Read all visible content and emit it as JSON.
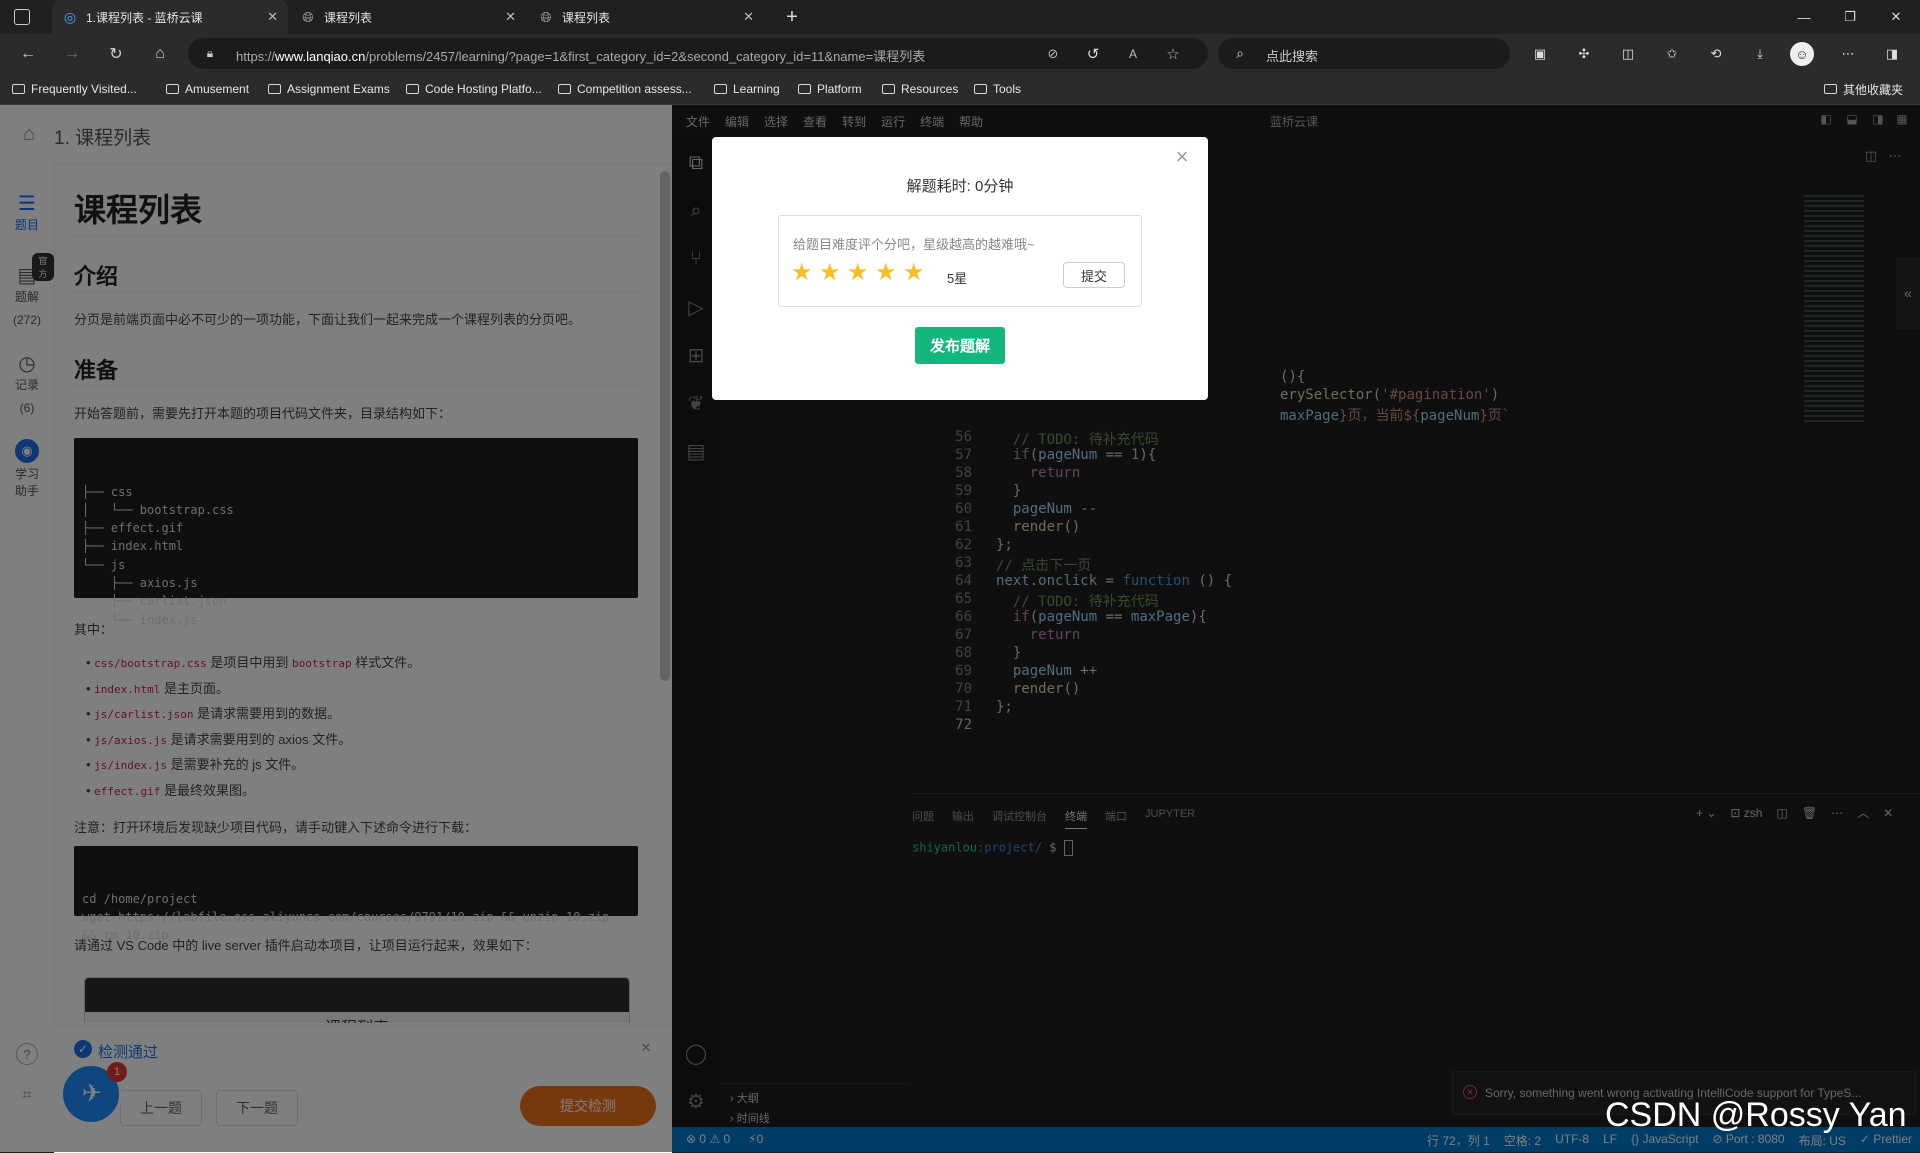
{
  "browser": {
    "tabs": [
      {
        "label": "1.课程列表 - 蓝桥云课",
        "active": true
      },
      {
        "label": "课程列表",
        "active": false
      },
      {
        "label": "课程列表",
        "active": false
      }
    ],
    "url_prefix": "https://",
    "url_host": "www.lanqiao.cn",
    "url_path": "/problems/2457/learning/?page=1&first_category_id=2&second_category_id=11&name=课程列表",
    "search_placeholder": "点此搜索",
    "bookmarks": [
      "Frequently Visited...",
      "Amusement",
      "Assignment Exams",
      "Code Hosting Platfo...",
      "Competition assess...",
      "Learning",
      "Platform",
      "Resources",
      "Tools"
    ],
    "other_bookmarks": "其他收藏夹"
  },
  "left": {
    "breadcrumb": "1. 课程列表",
    "rail": [
      {
        "label": "题目"
      },
      {
        "label": "题解",
        "count": "(272)",
        "badge": "官方"
      },
      {
        "label": "记录",
        "count": "(6)"
      },
      {
        "label": "学习\n助手"
      }
    ],
    "title": "课程列表",
    "intro_heading": "介绍",
    "intro_text": "分页是前端页面中必不可少的一项功能，下面让我们一起来完成一个课程列表的分页吧。",
    "prep_heading": "准备",
    "prep_text": "开始答题前，需要先打开本题的项目代码文件夹，目录结构如下：",
    "tree": [
      "├── css",
      "│   └── bootstrap.css",
      "├── effect.gif",
      "├── index.html",
      "└── js",
      "    ├── axios.js",
      "    ├── carlist.json",
      "    └── index.js"
    ],
    "among": "其中：",
    "items": [
      {
        "code": "css/bootstrap.css",
        "text1": " 是项目中用到 ",
        "code2": "bootstrap",
        "text2": " 样式文件。"
      },
      {
        "code": "index.html",
        "text1": " 是主页面。"
      },
      {
        "code": "js/carlist.json",
        "text1": " 是请求需要用到的数据。"
      },
      {
        "code": "js/axios.js",
        "text1": " 是请求需要用到的 axios 文件。"
      },
      {
        "code": "js/index.js",
        "text1": " 是需要补充的 js 文件。"
      },
      {
        "code": "effect.gif",
        "text1": " 是最终效果图。"
      }
    ],
    "note": "注意：打开环境后发现缺少项目代码，请手动键入下述命令进行下载：",
    "cmd": [
      "cd /home/project",
      "wget https://labfile.oss.aliyuncs.com/courses/9791/10.zip && unzip 10.zip",
      "&& rm 10.zip"
    ],
    "live_text": "请通过 VS Code 中的 live server 插件启动本项目，让项目运行起来，效果如下：",
    "preview_title": "课程列表",
    "check_pass": "检测通过",
    "prev": "上一题",
    "next": "下一题",
    "submit_check": "提交检测",
    "assistant_badge": "1"
  },
  "editor": {
    "menu": [
      "文件",
      "编辑",
      "选择",
      "查看",
      "转到",
      "运行",
      "终端",
      "帮助"
    ],
    "window_title": "蓝桥云课",
    "top_fragments": [
      {
        "ln": "",
        "html": "(){"
      },
      {
        "ln": "",
        "html": "erySelector('#pagination')"
      },
      {
        "ln": "",
        "html": "maxPage}页，当前${pageNum}页`"
      }
    ],
    "lines": [
      {
        "n": "56",
        "t": "  // TODO: 待补充代码"
      },
      {
        "n": "57",
        "t": "  if(pageNum == 1){"
      },
      {
        "n": "58",
        "t": "    return"
      },
      {
        "n": "59",
        "t": "  }"
      },
      {
        "n": "60",
        "t": "  pageNum --"
      },
      {
        "n": "61",
        "t": "  render()"
      },
      {
        "n": "62",
        "t": "};"
      },
      {
        "n": "63",
        "t": "// 点击下一页"
      },
      {
        "n": "64",
        "t": "next.onclick = function () {"
      },
      {
        "n": "65",
        "t": "  // TODO: 待补充代码"
      },
      {
        "n": "66",
        "t": "  if(pageNum == maxPage){"
      },
      {
        "n": "67",
        "t": "    return"
      },
      {
        "n": "68",
        "t": "  }"
      },
      {
        "n": "69",
        "t": "  pageNum ++"
      },
      {
        "n": "70",
        "t": "  render()"
      },
      {
        "n": "71",
        "t": "};"
      },
      {
        "n": "72",
        "t": ""
      }
    ],
    "panel_tabs": [
      "问题",
      "输出",
      "调试控制台",
      "终端",
      "端口",
      "JUPYTER"
    ],
    "active_panel": "终端",
    "shell": "zsh",
    "prompt_user": "shiyanlou",
    "prompt_path": ":project/",
    "prompt_sym": " $ ",
    "outline": "大纲",
    "timeline": "时间线",
    "notification": "Sorry, something went wrong activating IntelliCode support for TypeS...",
    "status_left": [
      "⊗ 0 ⚠ 0",
      "⚡0"
    ],
    "status_right": [
      "行 72，列 1",
      "空格: 2",
      "UTF-8",
      "LF",
      "{} JavaScript",
      "⊘ Port : 8080",
      "布局: US",
      "✓ Prettier"
    ]
  },
  "modal": {
    "time_label": "解题耗时: 0分钟",
    "prompt": "给题目难度评个分吧，星级越高的越难哦~",
    "stars": 5,
    "rating_text": "5星",
    "submit": "提交",
    "publish": "发布题解",
    "close": "×"
  },
  "watermark": "CSDN @Rossy Yan"
}
